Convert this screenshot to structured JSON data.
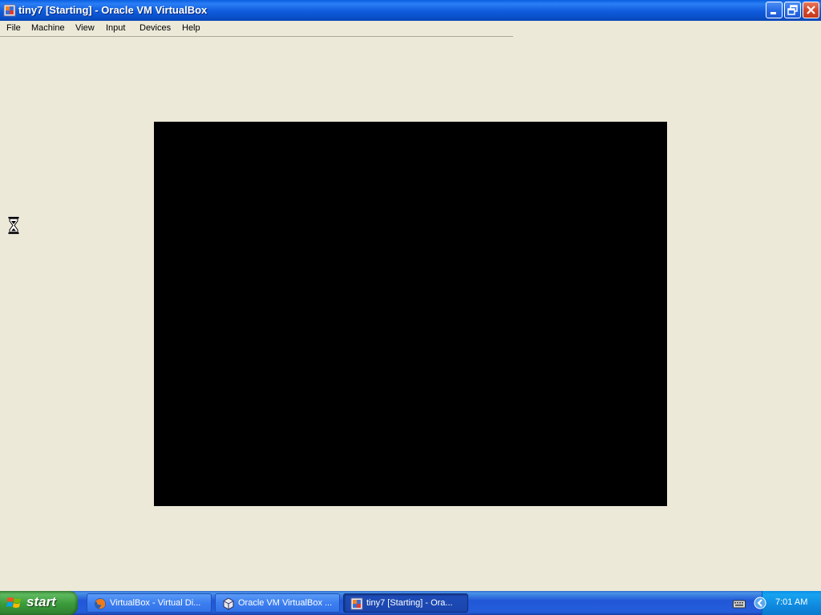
{
  "window": {
    "title": "tiny7 [Starting] - Oracle VM VirtualBox"
  },
  "menu": {
    "items": [
      "File",
      "Machine",
      "View",
      "Input",
      "Devices",
      "Help"
    ]
  },
  "taskbar": {
    "start_label": "start",
    "tasks": [
      {
        "label": "VirtualBox - Virtual Di...",
        "icon": "firefox-icon",
        "active": false
      },
      {
        "label": "Oracle VM VirtualBox ...",
        "icon": "virtualbox-icon",
        "active": false
      },
      {
        "label": "tiny7 [Starting] - Ora...",
        "icon": "virtualbox-vm-icon",
        "active": true
      }
    ],
    "clock": "7:01 AM"
  },
  "colors": {
    "titlebar": "#0a5fe0",
    "window_bg": "#ece9d8",
    "vm_screen": "#000000",
    "taskbar": "#245edb",
    "start_button": "#3a9a3a",
    "tray": "#0f8ae0"
  }
}
